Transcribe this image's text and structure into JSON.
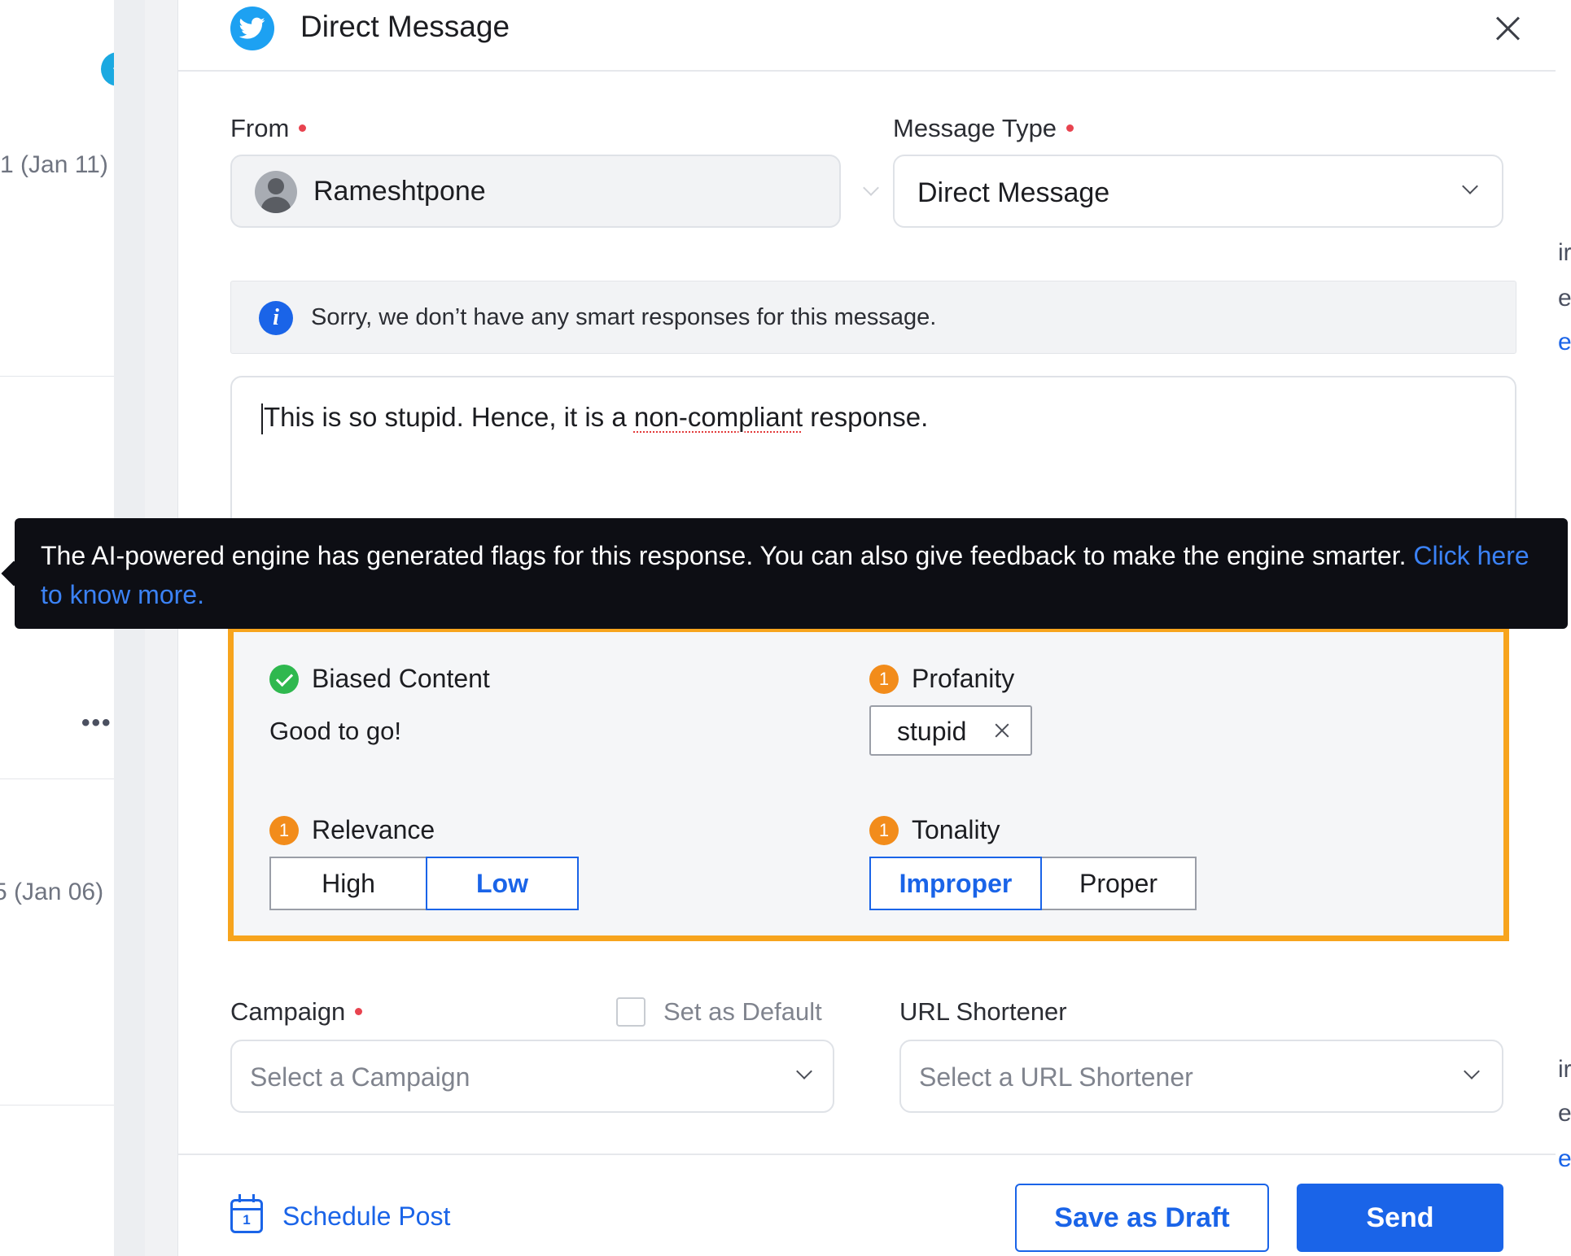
{
  "background": {
    "dates": [
      "1 (Jan 11)",
      "5 (Jan 06)"
    ],
    "more_label": "•••",
    "right_fragments": [
      "ir",
      "es",
      "e/",
      "ir",
      "es",
      "e/"
    ]
  },
  "modal": {
    "title": "Direct Message",
    "icons": {
      "channel": "twitter-icon",
      "close": "close-icon"
    },
    "from": {
      "label": "From",
      "value": "Rameshtpone"
    },
    "message_type": {
      "label": "Message Type",
      "value": "Direct Message"
    },
    "info_banner": "Sorry, we don’t have any smart responses for this message.",
    "editor": {
      "text_before": "This is so stupid. Hence, it is a ",
      "misspelled": "non-compliant",
      "text_after": " response."
    },
    "tooltip": {
      "text": "The AI-powered engine has generated flags for this response. You can also give feedback to make the engine smarter.",
      "link": "Click here to know more."
    },
    "flags": {
      "biased": {
        "title": "Biased Content",
        "status": "Good to go!"
      },
      "profanity": {
        "title": "Profanity",
        "count": "1",
        "word": "stupid"
      },
      "relevance": {
        "title": "Relevance",
        "count": "1",
        "options": [
          "High",
          "Low"
        ],
        "selected": "Low"
      },
      "tonality": {
        "title": "Tonality",
        "count": "1",
        "options": [
          "Improper",
          "Proper"
        ],
        "selected": "Improper"
      }
    },
    "campaign": {
      "label": "Campaign",
      "placeholder": "Select a Campaign",
      "default_label": "Set as Default"
    },
    "url_shortener": {
      "label": "URL Shortener",
      "placeholder": "Select a URL Shortener"
    },
    "footer": {
      "schedule": "Schedule Post",
      "calendar_day": "1",
      "save_draft": "Save as Draft",
      "send": "Send"
    }
  },
  "colors": {
    "primary": "#1a64e8",
    "flag_border": "#f7a41d",
    "warning": "#f28c1b",
    "success": "#2fb84f",
    "required": "#e8434f",
    "tooltip_bg": "#0d0e14",
    "twitter": "#1da1f2"
  }
}
